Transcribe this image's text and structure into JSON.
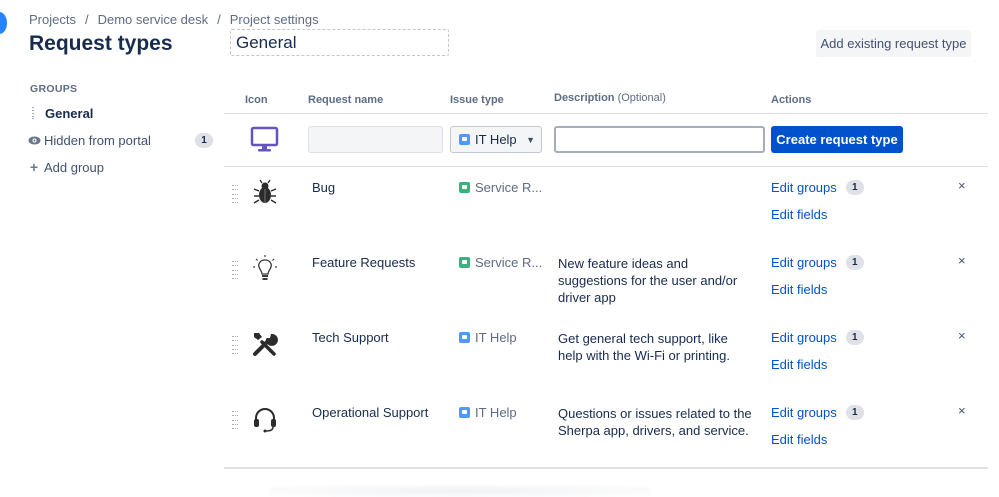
{
  "breadcrumb": [
    "Projects",
    "Demo service desk",
    "Project settings"
  ],
  "page_title": "Request types",
  "group_name_value": "General",
  "add_existing_label": "Add existing request type",
  "sidebar": {
    "heading": "GROUPS",
    "items": [
      {
        "label": "General",
        "icon": "drag-handle-icon",
        "active": true
      },
      {
        "label": "Hidden from portal",
        "icon": "eye-icon",
        "count": "1"
      },
      {
        "label": "Add group",
        "icon": "plus-icon"
      }
    ]
  },
  "table": {
    "headers": {
      "icon": "Icon",
      "request_name": "Request name",
      "issue_type": "Issue type",
      "description": "Description",
      "description_hint": "(Optional)",
      "actions": "Actions"
    },
    "create_row": {
      "icon": "monitor-icon",
      "name_value": "",
      "issue_type_selected": "IT Help",
      "description_value": "",
      "create_label": "Create request type"
    },
    "rows": [
      {
        "icon": "bug-icon",
        "name": "Bug",
        "issue_type": "Service R...",
        "issue_color": "#36b37e",
        "description": "",
        "edit_groups": "Edit groups",
        "groups_count": "1",
        "edit_fields": "Edit fields",
        "remove": "×"
      },
      {
        "icon": "lightbulb-icon",
        "name": "Feature Requests",
        "issue_type": "Service R...",
        "issue_color": "#36b37e",
        "description": "New feature ideas and suggestions for the user and/or driver app",
        "edit_groups": "Edit groups",
        "groups_count": "1",
        "edit_fields": "Edit fields",
        "remove": "×"
      },
      {
        "icon": "tools-icon",
        "name": "Tech Support",
        "issue_type": "IT Help",
        "issue_color": "#4c9aff",
        "description": "Get general tech support, like help with the Wi-Fi or printing.",
        "edit_groups": "Edit groups",
        "groups_count": "1",
        "edit_fields": "Edit fields",
        "remove": "×"
      },
      {
        "icon": "headset-icon",
        "name": "Operational Support",
        "issue_type": "IT Help",
        "issue_color": "#4c9aff",
        "description": "Questions or issues related to the Sherpa app, drivers, and service.",
        "edit_groups": "Edit groups",
        "groups_count": "1",
        "edit_fields": "Edit fields",
        "remove": "×"
      }
    ]
  },
  "colors": {
    "primary": "#0052cc",
    "text": "#172b4d",
    "subtle": "#5e6c84",
    "accent_dot": "#2684ff"
  }
}
